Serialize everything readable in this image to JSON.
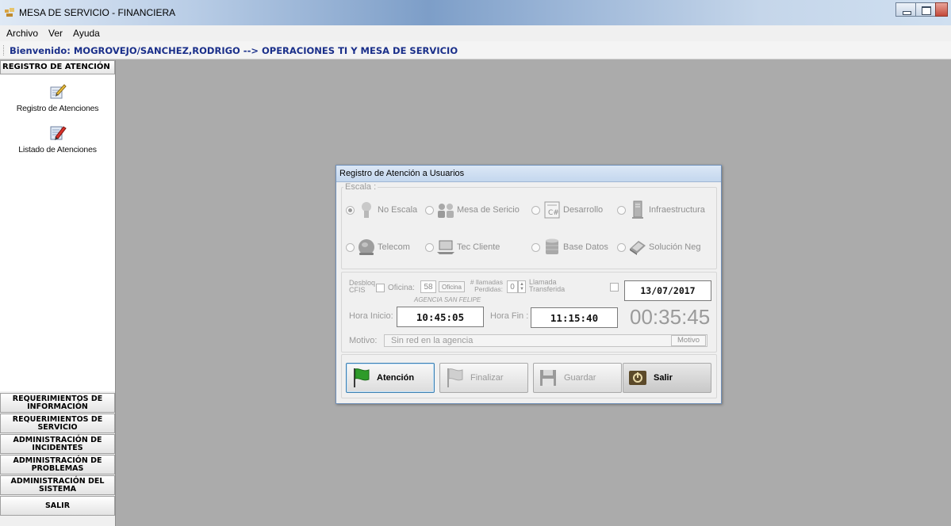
{
  "window": {
    "title": "MESA DE SERVICIO - FINANCIERA"
  },
  "menu": {
    "items": [
      "Archivo",
      "Ver",
      "Ayuda"
    ]
  },
  "welcome": {
    "text": "Bienvenido: MOGROVEJO/SANCHEZ,RODRIGO  --> OPERACIONES TI Y MESA DE SERVICIO"
  },
  "sidebar": {
    "header": "REGISTRO DE ATENCIÓN",
    "links": [
      {
        "label": "Registro de Atenciones",
        "icon": "edit-form-icon"
      },
      {
        "label": "Listado de Atenciones",
        "icon": "pencil-list-icon"
      }
    ],
    "sections": [
      "REQUERIMIENTOS DE INFORMACIÓN",
      "REQUERIMIENTOS DE SERVICIO",
      "ADMINISTRACIÓN DE INCIDENTES",
      "ADMINISTRACIÓN DE PROBLEMAS",
      "ADMINISTRACIÓN DEL SISTEMA",
      "SALIR"
    ]
  },
  "dialog": {
    "title": "Registro de Atención a Usuarios",
    "escala_label": "Escala :",
    "escala_options": [
      {
        "label": "No Escala",
        "selected": true,
        "icon": "user-silhouette-icon"
      },
      {
        "label": "Mesa de Sericio",
        "selected": false,
        "icon": "group-users-icon"
      },
      {
        "label": "Desarrollo",
        "selected": false,
        "icon": "csharp-file-icon"
      },
      {
        "label": "Infraestructura",
        "selected": false,
        "icon": "server-icon"
      },
      {
        "label": "Telecom",
        "selected": false,
        "icon": "globe-icon"
      },
      {
        "label": "Tec Cliente",
        "selected": false,
        "icon": "laptop-icon"
      },
      {
        "label": "Base Datos",
        "selected": false,
        "icon": "database-icon"
      },
      {
        "label": "Solución Neg",
        "selected": false,
        "icon": "book-icon"
      }
    ],
    "desbloq_label": "Desbloq CFIS",
    "oficina_label": "Oficina:",
    "oficina_value": "58",
    "oficina_button": "Oficina",
    "agencia": "AGENCIA SAN FELIPE",
    "llamadas_label": "# llamadas Perdidas:",
    "llamadas_value": "0",
    "llamada_transferida_label": "Llamada Transferida",
    "fecha": "13/07/2017",
    "hora_inicio_label": "Hora Inicio:",
    "hora_inicio": "10:45:05",
    "hora_fin_label": "Hora Fin :",
    "hora_fin": "11:15:40",
    "duracion": "00:35:45",
    "motivo_label": "Motivo:",
    "motivo_value": "Sin red en la agencia",
    "motivo_button": "Motivo",
    "buttons": {
      "atencion": "Atención",
      "finalizar": "Finalizar",
      "guardar": "Guardar",
      "salir": "Salir"
    }
  },
  "colors": {
    "welcome_text": "#1a2f8a",
    "desktop_bg": "#ababab",
    "flag_green": "#2e9b2a"
  }
}
